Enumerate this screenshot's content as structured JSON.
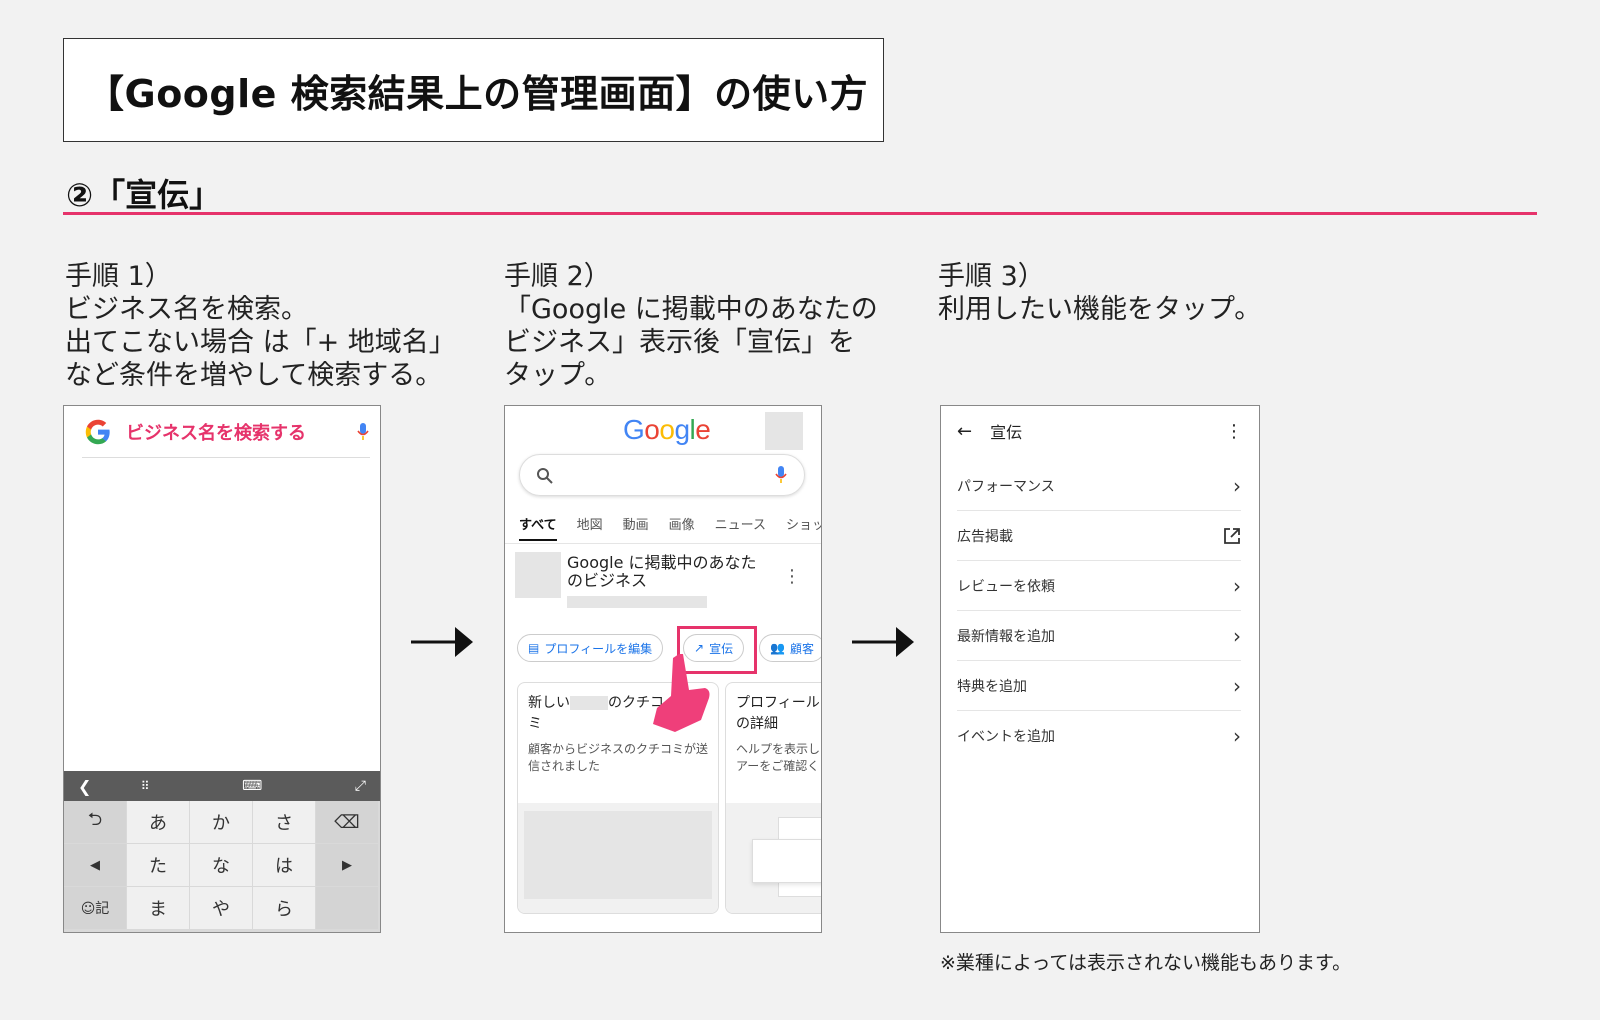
{
  "title": "【Google 検索結果上の管理画面】の使い方",
  "section": "②「宣伝」",
  "steps": [
    {
      "heading": "手順 1）",
      "lines": [
        "ビジネス名を検索。",
        "出てこない場合 は「+ 地域名」",
        "など条件を増やして検索する。"
      ]
    },
    {
      "heading": "手順 2）",
      "lines": [
        "「Google  に掲載中のあなたの",
        "ビジネス」表示後「宣伝」を",
        "タップ。"
      ]
    },
    {
      "heading": "手順 3）",
      "lines": [
        "利用したい機能をタップ。"
      ]
    }
  ],
  "phone1": {
    "search_placeholder": "ビジネス名を検索する",
    "keyboard": {
      "row1": [
        "⮌",
        "あ",
        "か",
        "さ",
        "⌫"
      ],
      "row2": [
        "◀",
        "た",
        "な",
        "は",
        "▶"
      ],
      "row3": [
        "☺記",
        "ま",
        "や",
        "ら",
        ""
      ]
    }
  },
  "phone2": {
    "logo": "Google",
    "tabs": [
      "すべて",
      "地図",
      "動画",
      "画像",
      "ニュース",
      "ショッ"
    ],
    "business_title": "Google に掲載中のあなたのビジネス",
    "chips": [
      "プロフィールを編集",
      "宣伝",
      "顧客"
    ],
    "card1": {
      "title_a": "新しい",
      "title_b": "のクチコ",
      "title_c": "ミ",
      "desc": "顧客からビジネスのクチコミが送信されました"
    },
    "card2": {
      "title": "プロフィールの詳細",
      "desc": "ヘルプを表示しアーをご確認く"
    }
  },
  "phone3": {
    "header": "宣伝",
    "items": [
      "パフォーマンス",
      "広告掲載",
      "レビューを依頼",
      "最新情報を追加",
      "特典を追加",
      "イベントを追加"
    ]
  },
  "note": "※業種によっては表示されない機能もあります。",
  "colors": {
    "accent": "#e6336b",
    "google_blue": "#1a73e8"
  }
}
